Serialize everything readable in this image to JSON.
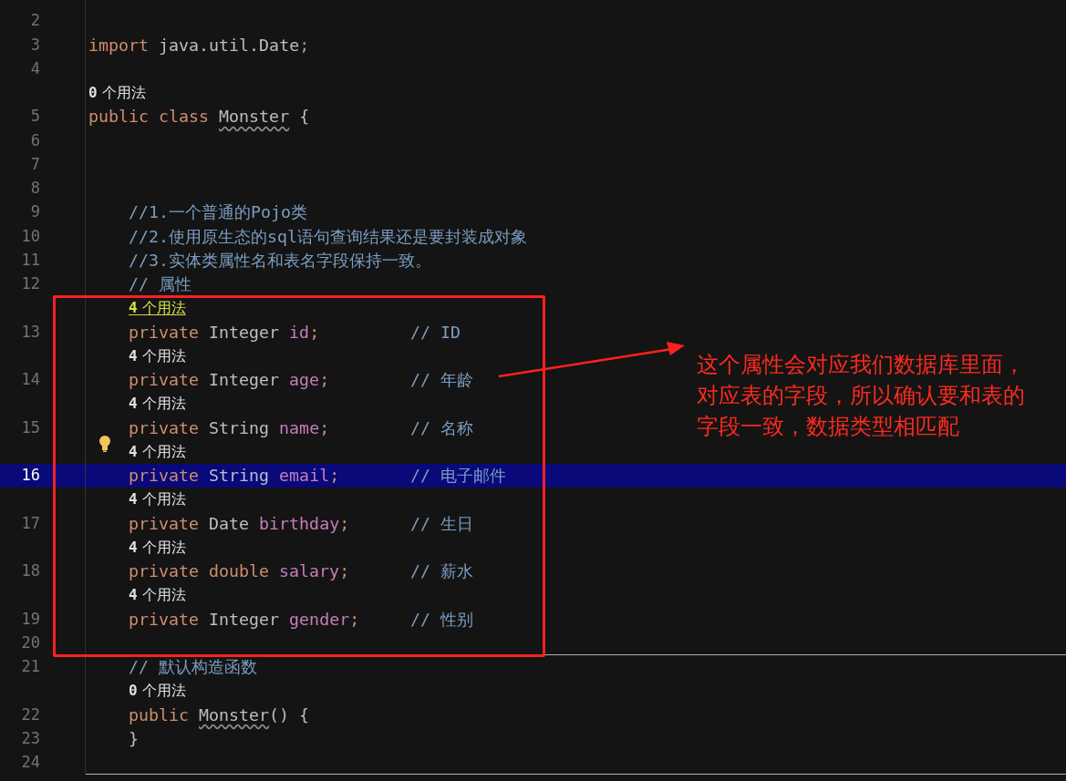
{
  "editor": {
    "lines": [
      {
        "kind": "code",
        "number": "2",
        "current": false,
        "separator_below": false
      },
      {
        "kind": "code",
        "number": "3",
        "member": false,
        "current": false,
        "separator_below": false,
        "tokens": [
          {
            "kind": "keyword",
            "text": "import"
          },
          {
            "kind": "plain",
            "text": " java.util.Date"
          },
          {
            "kind": "keyword",
            "text": ";"
          }
        ]
      },
      {
        "kind": "code",
        "number": "4",
        "current": false,
        "separator_below": false
      },
      {
        "kind": "hint",
        "member": false,
        "count": "0",
        "label": "个用法",
        "highlighted": false
      },
      {
        "kind": "code",
        "number": "5",
        "member": false,
        "current": false,
        "separator_below": false,
        "tokens": [
          {
            "kind": "keyword",
            "text": "public class "
          },
          {
            "kind": "class_name",
            "text": "Monster"
          },
          {
            "kind": "plain",
            "text": " {"
          }
        ]
      },
      {
        "kind": "code",
        "number": "6",
        "current": false,
        "separator_below": false
      },
      {
        "kind": "code",
        "number": "7",
        "current": false,
        "separator_below": false
      },
      {
        "kind": "code",
        "number": "8",
        "current": false,
        "separator_below": false
      },
      {
        "kind": "code",
        "number": "9",
        "member": true,
        "current": false,
        "separator_below": false,
        "tokens": [
          {
            "kind": "comment",
            "text": "//1.一个普通的Pojo类"
          }
        ]
      },
      {
        "kind": "code",
        "number": "10",
        "member": true,
        "current": false,
        "separator_below": false,
        "tokens": [
          {
            "kind": "comment",
            "text": "//2.使用原生态的sql语句查询结果还是要封装成对象"
          }
        ]
      },
      {
        "kind": "code",
        "number": "11",
        "member": true,
        "current": false,
        "separator_below": false,
        "tokens": [
          {
            "kind": "comment",
            "text": "//3.实体类属性名和表名字段保持一致。"
          }
        ]
      },
      {
        "kind": "code",
        "number": "12",
        "member": true,
        "current": false,
        "separator_below": false,
        "tokens": [
          {
            "kind": "comment",
            "text": "// 属性"
          }
        ]
      },
      {
        "kind": "hint",
        "member": true,
        "count": "4",
        "label": "个用法",
        "highlighted": true,
        "bulb": false
      },
      {
        "kind": "code",
        "number": "13",
        "member": true,
        "current": false,
        "separator_below": false,
        "tokens": [
          {
            "kind": "keyword",
            "text": "private"
          },
          {
            "kind": "plain",
            "text": " Integer "
          },
          {
            "kind": "field",
            "text": "id"
          },
          {
            "kind": "keyword",
            "text": ";"
          },
          {
            "kind": "trailing_comment",
            "text": "// ID"
          }
        ]
      },
      {
        "kind": "hint",
        "member": true,
        "count": "4",
        "label": "个用法",
        "highlighted": false,
        "bulb": false
      },
      {
        "kind": "code",
        "number": "14",
        "member": true,
        "current": false,
        "separator_below": false,
        "tokens": [
          {
            "kind": "keyword",
            "text": "private"
          },
          {
            "kind": "plain",
            "text": " Integer "
          },
          {
            "kind": "field",
            "text": "age"
          },
          {
            "kind": "keyword",
            "text": ";"
          },
          {
            "kind": "trailing_comment",
            "text": "// 年龄"
          }
        ]
      },
      {
        "kind": "hint",
        "member": true,
        "count": "4",
        "label": "个用法",
        "highlighted": false,
        "bulb": false
      },
      {
        "kind": "code",
        "number": "15",
        "member": true,
        "current": false,
        "separator_below": false,
        "tokens": [
          {
            "kind": "keyword",
            "text": "private"
          },
          {
            "kind": "plain",
            "text": " String "
          },
          {
            "kind": "field",
            "text": "name"
          },
          {
            "kind": "keyword",
            "text": ";"
          },
          {
            "kind": "trailing_comment",
            "text": "// 名称"
          }
        ]
      },
      {
        "kind": "hint",
        "member": true,
        "count": "4",
        "label": "个用法",
        "highlighted": false,
        "bulb": true
      },
      {
        "kind": "code",
        "number": "16",
        "member": true,
        "current": true,
        "separator_below": false,
        "tokens": [
          {
            "kind": "keyword",
            "text": "private"
          },
          {
            "kind": "plain",
            "text": " String "
          },
          {
            "kind": "field",
            "text": "email"
          },
          {
            "kind": "keyword",
            "text": ";"
          },
          {
            "kind": "trailing_comment",
            "text": "// 电子邮件"
          }
        ]
      },
      {
        "kind": "hint",
        "member": true,
        "count": "4",
        "label": "个用法",
        "highlighted": false,
        "bulb": false
      },
      {
        "kind": "code",
        "number": "17",
        "member": true,
        "current": false,
        "separator_below": false,
        "tokens": [
          {
            "kind": "keyword",
            "text": "private"
          },
          {
            "kind": "plain",
            "text": " Date "
          },
          {
            "kind": "field",
            "text": "birthday"
          },
          {
            "kind": "keyword",
            "text": ";"
          },
          {
            "kind": "trailing_comment",
            "text": "// 生日"
          }
        ]
      },
      {
        "kind": "hint",
        "member": true,
        "count": "4",
        "label": "个用法",
        "highlighted": false,
        "bulb": false
      },
      {
        "kind": "code",
        "number": "18",
        "member": true,
        "current": false,
        "separator_below": false,
        "tokens": [
          {
            "kind": "keyword",
            "text": "private double "
          },
          {
            "kind": "field",
            "text": "salary"
          },
          {
            "kind": "keyword",
            "text": ";"
          },
          {
            "kind": "trailing_comment",
            "text": "// 薪水"
          }
        ]
      },
      {
        "kind": "hint",
        "member": true,
        "count": "4",
        "label": "个用法",
        "highlighted": false,
        "bulb": false
      },
      {
        "kind": "code",
        "number": "19",
        "member": true,
        "current": false,
        "separator_below": false,
        "tokens": [
          {
            "kind": "keyword",
            "text": "private"
          },
          {
            "kind": "plain",
            "text": " Integer "
          },
          {
            "kind": "field",
            "text": "gender"
          },
          {
            "kind": "keyword",
            "text": ";"
          },
          {
            "kind": "trailing_comment",
            "text": "// 性别"
          }
        ]
      },
      {
        "kind": "code",
        "number": "20",
        "current": false,
        "separator_below": true
      },
      {
        "kind": "code",
        "number": "21",
        "member": true,
        "current": false,
        "separator_below": false,
        "tokens": [
          {
            "kind": "comment",
            "text": "// 默认构造函数"
          }
        ]
      },
      {
        "kind": "hint",
        "member": true,
        "count": "0",
        "label": "个用法",
        "highlighted": false,
        "bulb": false
      },
      {
        "kind": "code",
        "number": "22",
        "member": true,
        "current": false,
        "separator_below": false,
        "tokens": [
          {
            "kind": "keyword",
            "text": "public "
          },
          {
            "kind": "class_name",
            "text": "Monster"
          },
          {
            "kind": "plain",
            "text": "() {"
          }
        ]
      },
      {
        "kind": "code",
        "number": "23",
        "member": true,
        "current": false,
        "separator_below": false,
        "tokens": [
          {
            "kind": "plain",
            "text": "}"
          }
        ]
      },
      {
        "kind": "code",
        "number": "24",
        "current": false,
        "separator_below": true
      }
    ]
  },
  "annotation": {
    "lines": [
      "这个属性会对应我们数据库里面，",
      "对应表的字段，所以确认要和表的",
      "字段一致，数据类型相匹配"
    ]
  }
}
